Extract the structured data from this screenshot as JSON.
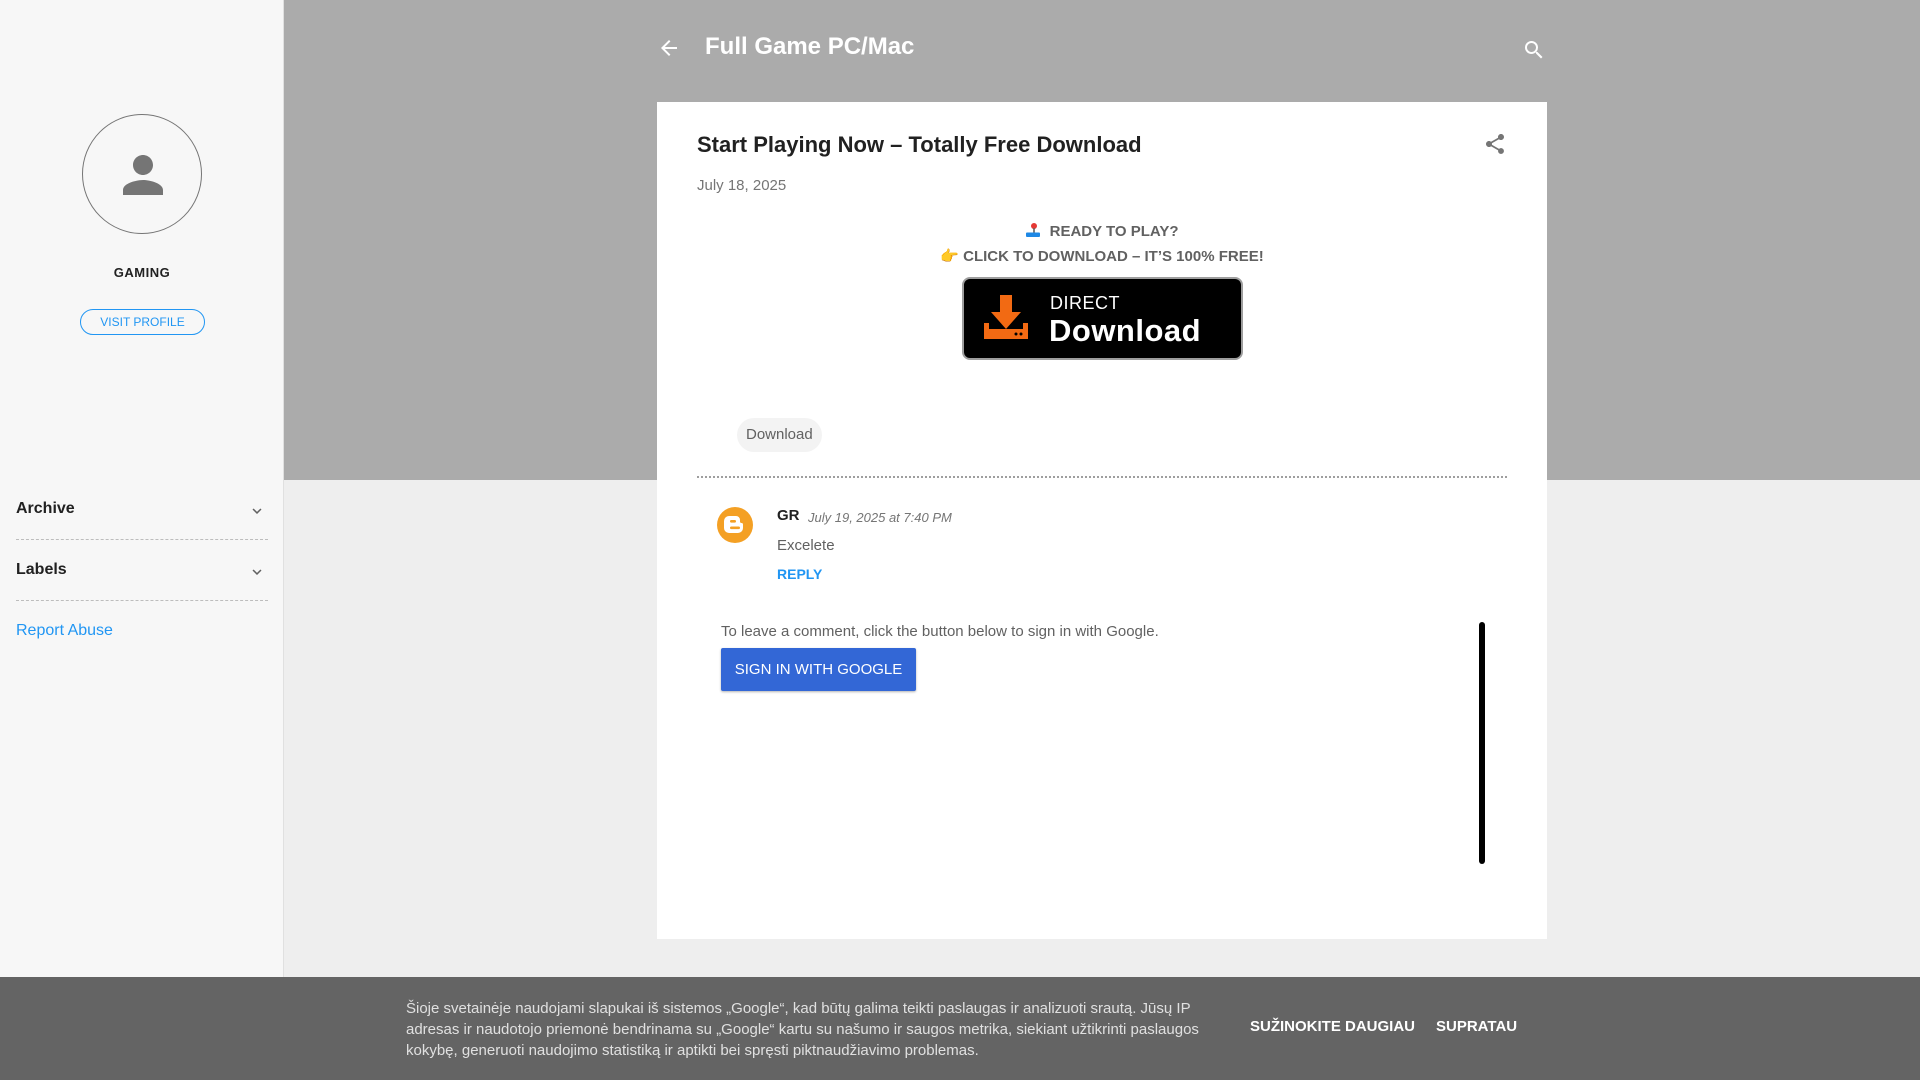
{
  "sidebar": {
    "profile_name": "GAMING",
    "visit_profile_label": "VISIT PROFILE",
    "widgets": [
      {
        "title": "Archive"
      },
      {
        "title": "Labels"
      }
    ],
    "report_abuse_label": "Report Abuse"
  },
  "header": {
    "blog_title": "Full Game PC/Mac"
  },
  "post": {
    "title": "Start Playing Now – Totally Free Download",
    "date": "July 18, 2025",
    "ready_line": "READY TO PLAY?",
    "click_line": "CLICK TO DOWNLOAD – IT’S 100% FREE!",
    "click_emoji": "👉",
    "download_button": {
      "small_text": "DIRECT",
      "big_text": "Download"
    },
    "label": "Download"
  },
  "comment": {
    "author": "GR",
    "timestamp": "July 19, 2025 at 7:40 PM",
    "body": "Excelete",
    "reply_label": "REPLY"
  },
  "signin": {
    "text": "To leave a comment, click the button below to sign in with Google.",
    "button_label": "SIGN IN WITH GOOGLE"
  },
  "cookie": {
    "text": "Šioje svetainėje naudojami slapukai iš sistemos „Google“, kad būtų galima teikti paslaugas ir analizuoti srautą. Jūsų IP adresas ir naudotojo priemonė bendrinama su „Google“ kartu su našumo ir saugos metrika, siekiant užtikrinti paslaugos kokybę, generuoti naudojimo statistiką ir aptikti bei spręsti piktnaudžiavimo problemas.",
    "learn_more_label": "SUŽINOKITE DAUGIAU",
    "ok_label": "SUPRATAU"
  },
  "icons": {
    "back": "arrow-back-icon",
    "search": "search-icon",
    "share": "share-icon",
    "avatar": "person-icon",
    "chevron": "chevron-down-icon",
    "blogger": "blogger-icon",
    "download": "download-icon",
    "joystick": "joystick-icon"
  },
  "colors": {
    "accent": "#2196f3",
    "header_band": "#ababab",
    "signin_button": "#3367d6",
    "blogger_orange": "#f4a024",
    "download_orange": "#f26a13"
  }
}
